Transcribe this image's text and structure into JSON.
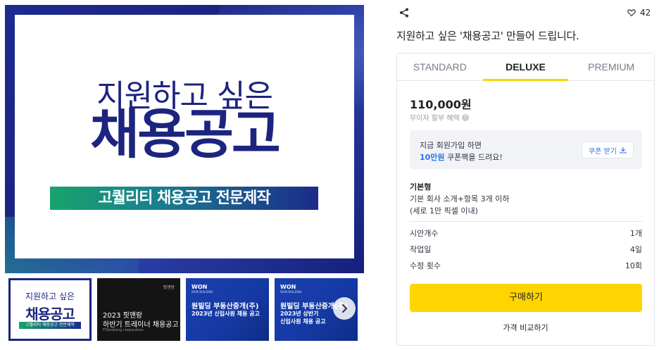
{
  "gallery": {
    "main": {
      "line1": "지원하고 싶은",
      "line2": "채용공고",
      "banner": "고퀄리티 채용공고 전문제작"
    },
    "thumbs": [
      {
        "line1": "지원하고 싶은",
        "line2": "채용공고",
        "line3": "고퀄리티 채용공고 전문제작"
      },
      {
        "logo": "핏앤랑",
        "line1": "2023 핏앤랑",
        "line2": "하반기 트레이너 채용공고",
        "line3": "FITandrang corporation"
      },
      {
        "brand": "WON",
        "brand_sub": "WON BUILDING",
        "line1": "원빌딩 부동산중개(주)",
        "line2": "2023년 신입사원 채용 공고"
      },
      {
        "brand": "WON",
        "brand_sub": "WON BUILDING",
        "line1": "원빌딩 부동산중개(주)",
        "line2": "2023년 상반기",
        "line3": "신입사원 채용 공고"
      }
    ],
    "next_icon": "chevron-right-icon"
  },
  "header": {
    "share_icon": "share-icon",
    "like_icon": "heart-icon",
    "like_count": "42",
    "title": "지원하고 싶은 '채용공고' 만들어 드립니다."
  },
  "package": {
    "tabs": [
      {
        "label": "STANDARD",
        "active": false
      },
      {
        "label": "DELUXE",
        "active": true
      },
      {
        "label": "PREMIUM",
        "active": false
      }
    ],
    "price": "110,000원",
    "installment": "무이자 할부 혜택",
    "installment_help": "?",
    "coupon": {
      "line1": "지금 회원가입 하면",
      "highlight": "10만원",
      "line2_rest": " 쿠폰팩을 드려요!",
      "button": "쿠폰 받기",
      "button_icon": "download-icon"
    },
    "name": "기본형",
    "desc1": "기본 회사 소개+항목 3개 이하",
    "desc2": "(세로 1만 픽셀 이내)",
    "specs": [
      {
        "label": "시안개수",
        "value": "1개"
      },
      {
        "label": "작업일",
        "value": "4일"
      },
      {
        "label": "수정 횟수",
        "value": "10회"
      }
    ],
    "buy_label": "구매하기",
    "compare_label": "가격 비교하기"
  },
  "colors": {
    "accent_yellow": "#ffd400",
    "brand_navy": "#1c2480",
    "link_blue": "#2d73e8"
  }
}
